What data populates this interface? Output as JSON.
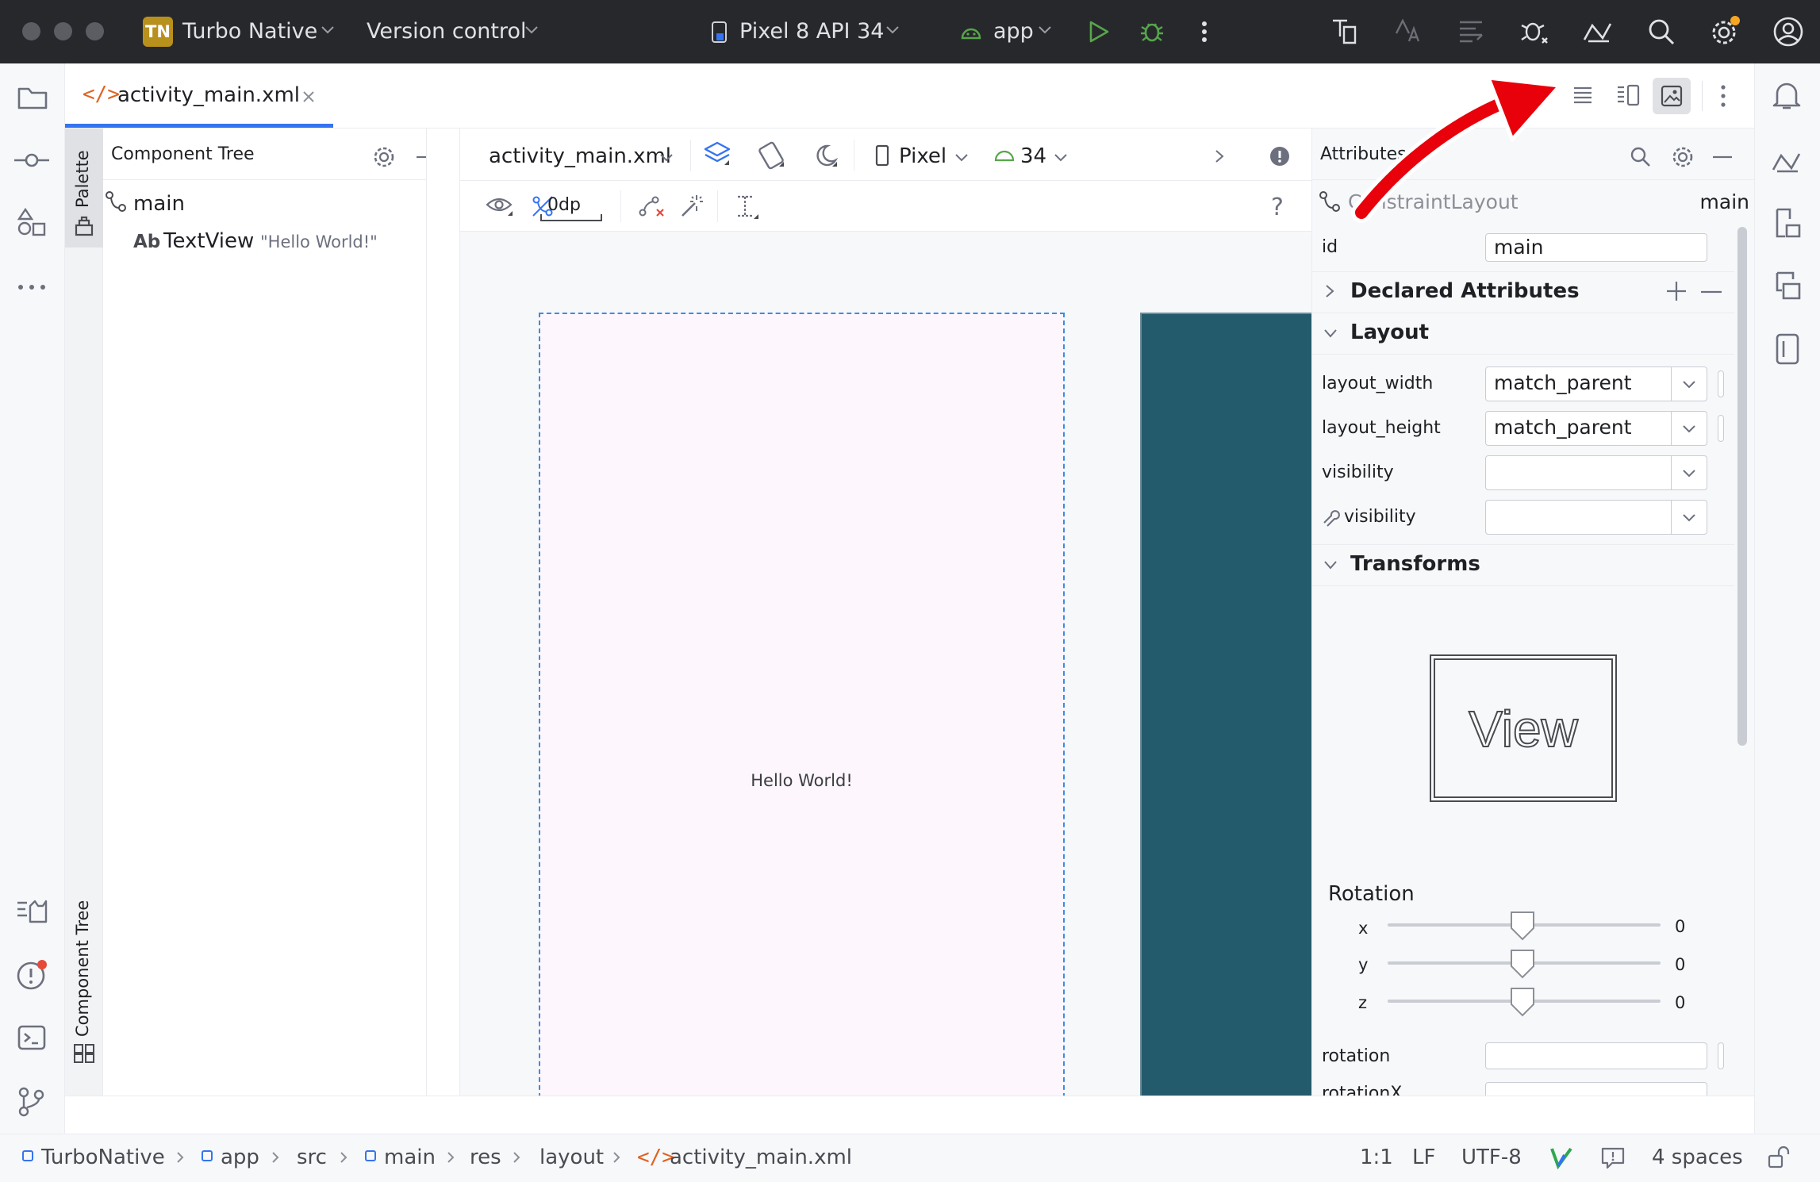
{
  "titlebar": {
    "project_badge": "TN",
    "project_name": "Turbo Native",
    "vcs": "Version control",
    "device": "Pixel 8 API 34",
    "run_config": "app"
  },
  "editor_tab": {
    "label": "activity_main.xml"
  },
  "component_tree": {
    "title": "Component Tree",
    "palette_label": "Palette",
    "side_label": "Component Tree",
    "root": "main",
    "child_prefix": "Ab",
    "child_name": "TextView",
    "child_text": "\"Hello World!\""
  },
  "design_toolbar": {
    "file": "activity_main.xml",
    "device": "Pixel",
    "api": "34",
    "margin": "0dp",
    "help": "?"
  },
  "canvas": {
    "hello": "Hello World!",
    "blueprint_color": "#245b6c",
    "design_bg": "#fdf6fd",
    "selection_color": "#3f8ae2"
  },
  "attributes": {
    "title": "Attributes",
    "component": "ConstraintLayout",
    "component_id": "main",
    "id_label": "id",
    "id_value": "main",
    "declared": "Declared Attributes",
    "layout": "Layout",
    "rows": [
      {
        "label": "layout_width",
        "value": "match_parent"
      },
      {
        "label": "layout_height",
        "value": "match_parent"
      },
      {
        "label": "visibility",
        "value": ""
      },
      {
        "label": "visibility",
        "value": ""
      }
    ],
    "transforms": "Transforms",
    "preview": "View",
    "rotation_title": "Rotation",
    "axes": [
      {
        "label": "x",
        "value": "0"
      },
      {
        "label": "y",
        "value": "0"
      },
      {
        "label": "z",
        "value": "0"
      }
    ],
    "rotation_label": "rotation",
    "rotationx_label": "rotationX"
  },
  "breadcrumb": [
    "TurboNative",
    "app",
    "src",
    "main",
    "res",
    "layout",
    "activity_main.xml"
  ],
  "status": {
    "position": "1:1",
    "line_sep": "LF",
    "encoding": "UTF-8",
    "indent": "4 spaces"
  },
  "colors": {
    "accent": "#3574f0",
    "arrow": "#e8000b",
    "xml_icon": "#e0621f",
    "run_green": "#57a64a"
  }
}
